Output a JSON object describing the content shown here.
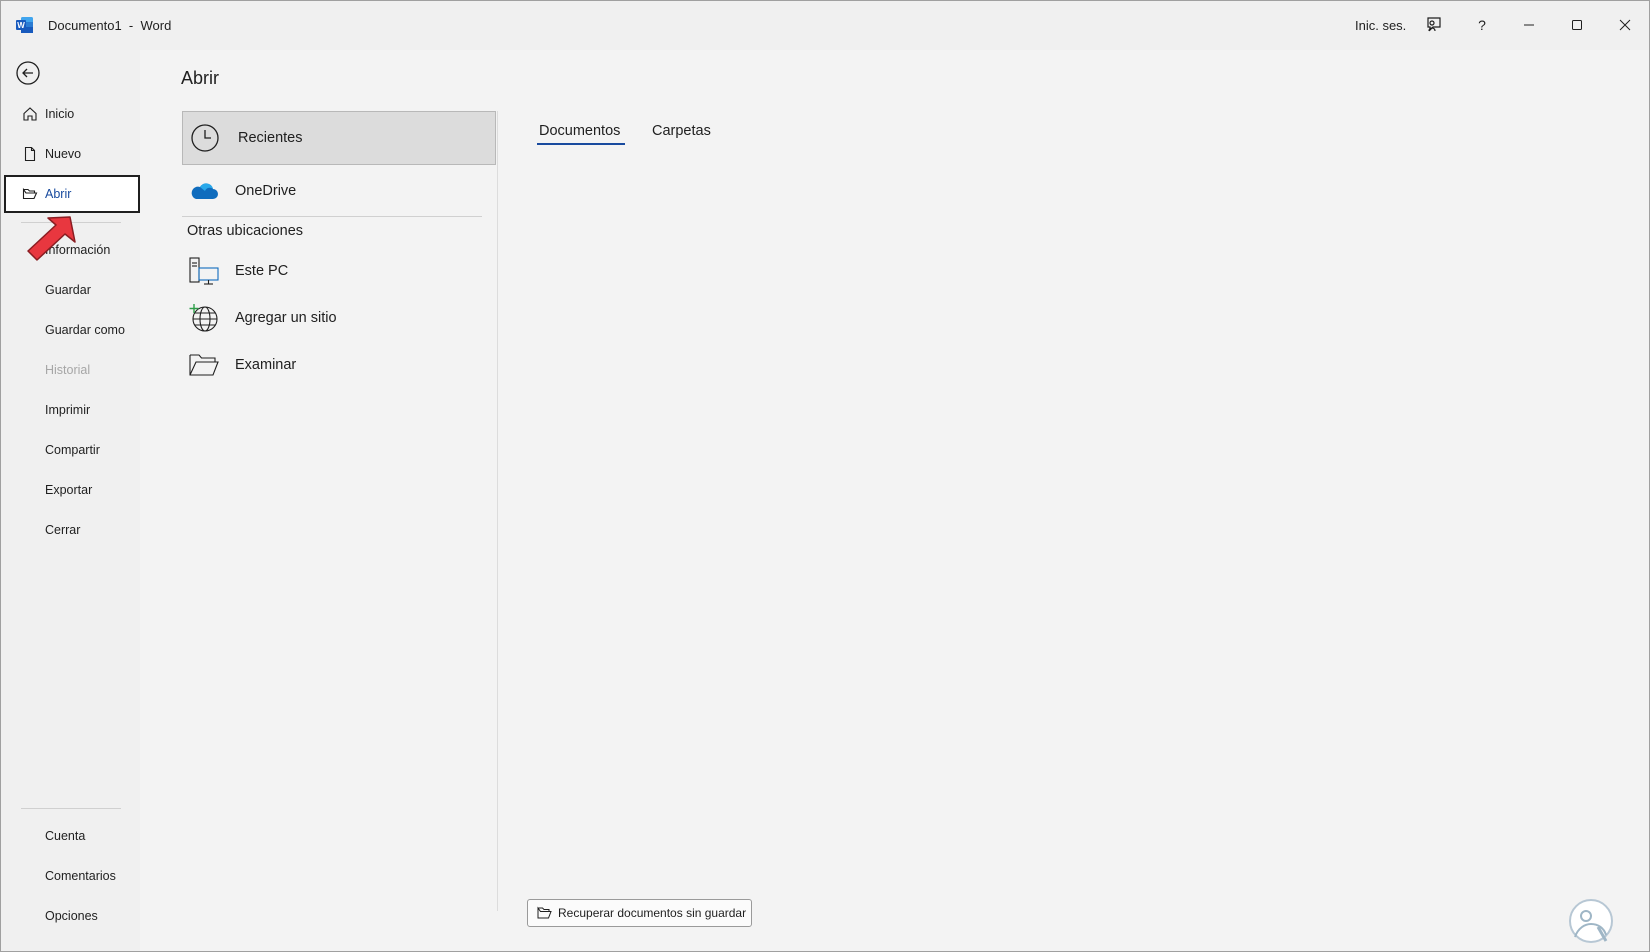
{
  "window": {
    "title": "Documento1  -  Word",
    "signin_label": "Inic. ses.",
    "icons": [
      "word-icon",
      "coauthoring-icon",
      "help-icon",
      "minimize-icon",
      "maximize-icon",
      "close-icon"
    ]
  },
  "nav": {
    "items": [
      {
        "label": "Inicio",
        "icon": "home-icon"
      },
      {
        "label": "Nuevo",
        "icon": "new-document-icon"
      },
      {
        "label": "Abrir",
        "icon": "open-folder-icon",
        "selected": true
      },
      {
        "label": "Información"
      },
      {
        "label": "Guardar"
      },
      {
        "label": "Guardar como"
      },
      {
        "label": "Historial",
        "disabled": true
      },
      {
        "label": "Imprimir"
      },
      {
        "label": "Compartir"
      },
      {
        "label": "Exportar"
      },
      {
        "label": "Cerrar"
      }
    ],
    "bottom_items": [
      {
        "label": "Cuenta"
      },
      {
        "label": "Comentarios"
      },
      {
        "label": "Opciones"
      }
    ]
  },
  "main": {
    "title": "Abrir",
    "locations": [
      {
        "label": "Recientes",
        "icon": "clock-icon",
        "selected": true
      },
      {
        "label": "OneDrive",
        "icon": "onedrive-icon"
      }
    ],
    "other_locations_header": "Otras ubicaciones",
    "other_locations": [
      {
        "label": "Este PC",
        "icon": "computer-icon"
      },
      {
        "label": "Agregar un sitio",
        "icon": "globe-add-icon"
      },
      {
        "label": "Examinar",
        "icon": "folder-icon"
      }
    ],
    "tabs": [
      {
        "label": "Documentos",
        "active": true
      },
      {
        "label": "Carpetas"
      }
    ],
    "recover_button": "Recuperar documentos sin guardar"
  },
  "colors": {
    "accent": "#184a9e",
    "onedrive": "#0f6cbd",
    "annotation_arrow": "#e8373f"
  }
}
